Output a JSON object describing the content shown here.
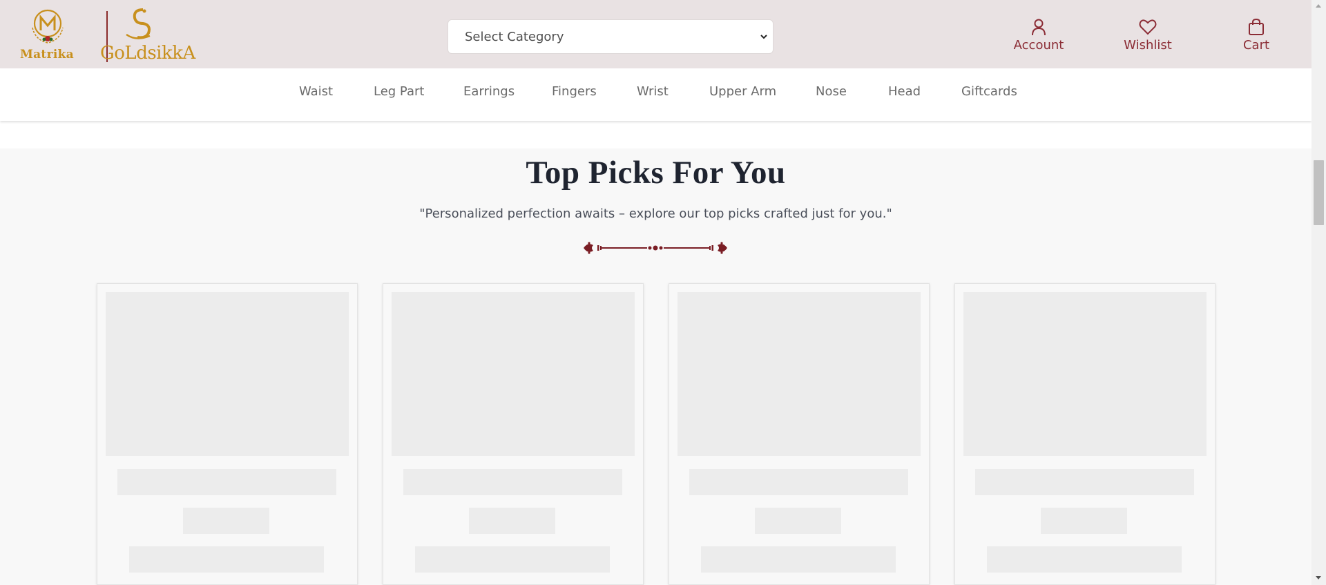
{
  "header": {
    "logos": {
      "matrika": "Matrika",
      "goldsikka": "GoLdsikkA"
    },
    "category_select": {
      "selected": "Select Category",
      "icon": "chevron-down-icon"
    },
    "actions": [
      {
        "label": "Account",
        "icon": "user-icon"
      },
      {
        "label": "Wishlist",
        "icon": "heart-icon"
      },
      {
        "label": "Cart",
        "icon": "shopping-bag-icon"
      }
    ]
  },
  "nav": {
    "items": [
      {
        "label": "Waist"
      },
      {
        "label": "Leg Part"
      },
      {
        "label": "Earrings"
      },
      {
        "label": "Fingers"
      },
      {
        "label": "Wrist"
      },
      {
        "label": "Upper Arm"
      },
      {
        "label": "Nose"
      },
      {
        "label": "Head"
      },
      {
        "label": "Giftcards"
      }
    ]
  },
  "main": {
    "title": "Top Picks For You",
    "subtitle": "\"Personalized perfection awaits – explore our top picks crafted just for you.\"",
    "ornament_icon": "decorative-divider-icon",
    "cards_loading": 4
  },
  "colors": {
    "header_bg": "#e9e2e3",
    "accent": "#8b2c35",
    "gold": "#c8901d",
    "skeleton": "#ececec",
    "section_bg": "#f8f8f8"
  }
}
